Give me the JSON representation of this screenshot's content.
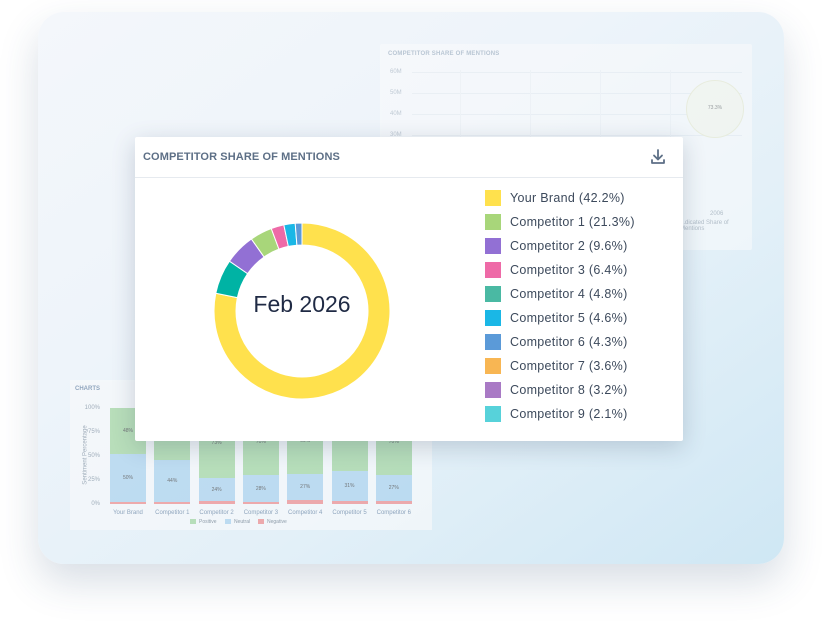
{
  "main_chart": {
    "title": "COMPETITOR SHARE OF MENTIONS",
    "center_label": "Feb 2026",
    "download_icon": "download-icon",
    "chart_data": {
      "type": "pie",
      "title": "COMPETITOR SHARE OF MENTIONS",
      "categories": [
        "Your Brand",
        "Competitor 1",
        "Competitor 2",
        "Competitor 3",
        "Competitor 4",
        "Competitor 5",
        "Competitor 6",
        "Competitor 7",
        "Competitor 8",
        "Competitor 9"
      ],
      "values": [
        42.2,
        21.3,
        9.6,
        6.4,
        4.8,
        4.6,
        4.3,
        3.6,
        3.2,
        2.1
      ],
      "legend_labels": [
        "Your Brand (42.2%)",
        "Competitor 1 (21.3%)",
        "Competitor 2 (9.6%)",
        "Competitor 3 (6.4%)",
        "Competitor 4 (4.8%)",
        "Competitor 5 (4.6%)",
        "Competitor 6 (4.3%)",
        "Competitor 7 (3.6%)",
        "Competitor 8 (3.2%)",
        "Competitor 9 (2.1%)"
      ],
      "legend_colors": [
        "#ffe14d",
        "#a8d67a",
        "#9270d4",
        "#ee6aa7",
        "#4ab9a3",
        "#1ab7e6",
        "#5b9ad8",
        "#f8b653",
        "#a97ac5",
        "#57d2da"
      ],
      "donut_visible_colors": [
        "#ffe14d",
        "#00b3a4",
        "#9270d4",
        "#a8d67a",
        "#ee6aa7",
        "#1ab7e6",
        "#5b9ad8"
      ],
      "donut_visible_values": [
        82.7,
        6.7,
        6.0,
        4.3,
        2.5,
        2.2,
        1.3
      ],
      "legend_placement": "right"
    }
  },
  "bg_chart": {
    "title": "COMPETITOR SHARE OF MENTIONS",
    "chart_data": {
      "type": "scatter",
      "title": "COMPETITOR SHARE OF MENTIONS",
      "y_ticks": [
        "60M",
        "50M",
        "40M",
        "30M"
      ],
      "x_ticks": [
        "2006"
      ],
      "bubble_label": "73.3%",
      "x_label_partial": "...dicated Share of Mentions"
    }
  },
  "sentiment_chart": {
    "title": "CHARTS",
    "chart_data": {
      "type": "bar",
      "stacked": true,
      "ylabel": "Sentiment Percentage",
      "y_ticks": [
        "100%",
        "75%",
        "50%",
        "25%",
        "0%"
      ],
      "categories": [
        "Your Brand",
        "Competitor 1",
        "Competitor 2",
        "Competitor 3",
        "Competitor 4",
        "Competitor 5",
        "Competitor 6"
      ],
      "series": [
        {
          "name": "Positive",
          "color": "#a3d6a0",
          "values": [
            48,
            54,
            73,
            70,
            69,
            66,
            70
          ]
        },
        {
          "name": "Neutral",
          "color": "#acd3ef",
          "values": [
            50,
            44,
            24,
            28,
            27,
            31,
            27
          ]
        },
        {
          "name": "Negative",
          "color": "#f08c8c",
          "values": [
            2,
            2,
            3,
            2,
            4,
            3,
            3
          ]
        }
      ],
      "segment_labels": {
        "positive": [
          "48%",
          "",
          "73%",
          "70%",
          "69%",
          "66%",
          "70%"
        ],
        "neutral": [
          "50%",
          "44%",
          "24%",
          "28%",
          "27%",
          "31%",
          "27%"
        ]
      },
      "legend": [
        "Positive",
        "Neutral",
        "Negative"
      ]
    }
  }
}
